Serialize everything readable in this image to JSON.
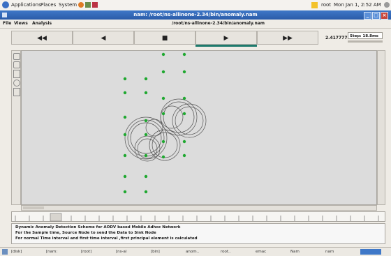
{
  "top_panel": {
    "applications": "Applications",
    "places": "Places",
    "system": "System",
    "user": "root",
    "clock": "Mon Jan 1,  2:52 AM"
  },
  "window": {
    "title": "nam: /root/ns-allinone-2.34/bin/anomaly.nam"
  },
  "menubar": {
    "file": "File",
    "views": "Views",
    "analysis": "Analysis",
    "path": "/root/ns-allinone-2.34/bin/anomaly.nam"
  },
  "transport": {
    "rewind": "◀◀",
    "back": "◀",
    "stop": "■",
    "play": "▶",
    "forward": "▶▶",
    "time": "2.417777",
    "step": "Step: 18.8ms"
  },
  "annotations": [
    "Dynamic Anomaly Detection Scheme for AODV based Mobile Adhoc Network",
    "For the Sample time, Source Node to send the Data to Sink Node",
    "For normal Time interval and first time interval ,first principal element is calculated"
  ],
  "taskbar": {
    "items": [
      "[disk]",
      "[nam:",
      "[root]",
      "[ns-al",
      "[bin]",
      "anom..",
      "root..",
      "emac",
      "Nam",
      "nam"
    ]
  },
  "colors": {
    "node": "#1fa830",
    "title_blue": "#2f66b8",
    "play_bar": "#1d7a6c"
  }
}
